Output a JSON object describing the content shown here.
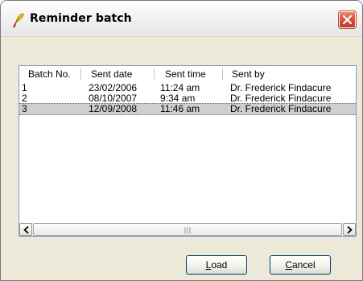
{
  "window": {
    "title": "Reminder batch"
  },
  "list": {
    "columns": [
      "Batch No.",
      "Sent date",
      "Sent time",
      "Sent by"
    ],
    "rows": [
      {
        "batch_no": "1",
        "sent_date": "23/02/2006",
        "sent_time": "11:24 am",
        "sent_by": "Dr. Frederick Findacure",
        "selected": false
      },
      {
        "batch_no": "2",
        "sent_date": "08/10/2007",
        "sent_time": "9:34 am",
        "sent_by": "Dr. Frederick Findacure",
        "selected": false
      },
      {
        "batch_no": "3",
        "sent_date": "12/09/2008",
        "sent_time": "11:46 am",
        "sent_by": "Dr. Frederick Findacure",
        "selected": true
      }
    ]
  },
  "buttons": {
    "load": {
      "mnemonic": "L",
      "rest": "oad"
    },
    "cancel": {
      "mnemonic": "C",
      "rest": "ancel"
    }
  },
  "colors": {
    "selected_row": "#cfcfcf",
    "close_button": "#d8553c",
    "list_border": "#7f9db9"
  }
}
